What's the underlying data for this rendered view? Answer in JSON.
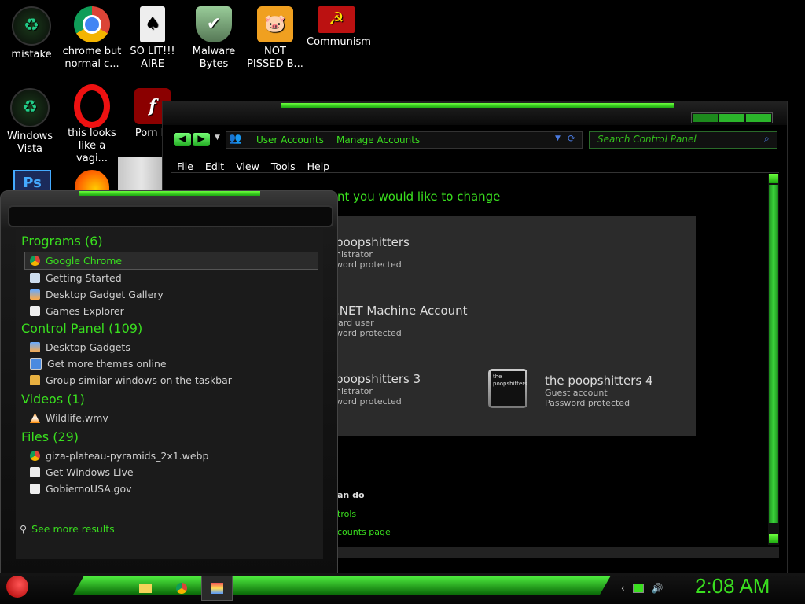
{
  "desktop": {
    "icons": [
      {
        "label": "mistake",
        "icon": "green-recycle-icon"
      },
      {
        "label": "chrome but\nnormal c...",
        "icon": "chrome-icon"
      },
      {
        "label": "SO LIT!!!\nAIRE",
        "icon": "solitaire-icon"
      },
      {
        "label": "Malware\nBytes",
        "icon": "shield-icon"
      },
      {
        "label": "NOT\nPISSED B...",
        "icon": "bad-piggies-icon"
      },
      {
        "label": "Communism",
        "icon": "hammer-sickle-icon"
      },
      {
        "label": "Windows\nVista",
        "icon": "recycle-bin-icon"
      },
      {
        "label": "this looks\nlike a vagi...",
        "icon": "opera-icon"
      },
      {
        "label": "Porn Pl",
        "icon": "flash-icon"
      }
    ]
  },
  "control_panel": {
    "breadcrumb": [
      "User Accounts",
      "Manage Accounts"
    ],
    "search_placeholder": "Search Control Panel",
    "menu": [
      "File",
      "Edit",
      "View",
      "Tools",
      "Help"
    ],
    "heading": "nt you would like to change",
    "accounts": [
      {
        "name": "poopshitters",
        "type": "nistrator",
        "status": "word protected"
      },
      {
        "name": ".NET Machine Account",
        "type": "lard user",
        "status": "word protected"
      },
      {
        "name": "poopshitters 3",
        "type": "nistrator",
        "status": "word protected"
      },
      {
        "name": "the poopshitters 4",
        "type": "Guest account",
        "status": "Password protected"
      }
    ],
    "avatar_text": "the poopshitters",
    "bottom_text": "an do",
    "bottom_links": [
      "trols",
      "counts page"
    ]
  },
  "start_menu": {
    "sections": [
      {
        "title": "Programs (6)",
        "items": [
          "Google Chrome",
          "Getting Started",
          "Desktop Gadget Gallery",
          "Games Explorer"
        ]
      },
      {
        "title": "Control Panel (109)",
        "items": [
          "Desktop Gadgets",
          "Get more themes online",
          "Group similar windows on the taskbar"
        ]
      },
      {
        "title": "Videos (1)",
        "items": [
          "Wildlife.wmv"
        ]
      },
      {
        "title": "Files (29)",
        "items": [
          "giza-plateau-pyramids_2x1.webp",
          "Get Windows Live",
          "GobiernoUSA.gov"
        ]
      }
    ],
    "see_more": "See more results"
  },
  "taskbar": {
    "clock": "2:08 AM"
  },
  "colors": {
    "accent": "#3adf1f",
    "bg": "#000000"
  }
}
